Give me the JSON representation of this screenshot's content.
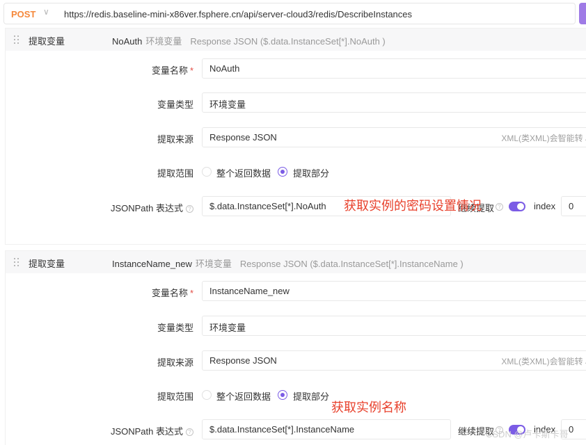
{
  "request": {
    "method": "POST",
    "url": "https://redis.baseline-mini-x86ver.fsphere.cn/api/server-cloud3/redis/DescribeInstances"
  },
  "extractions": [
    {
      "header_title": "提取变量",
      "summary_name": "NoAuth",
      "summary_type": "环境变量",
      "summary_source": "Response JSON ($.data.InstanceSet[*].NoAuth )",
      "name_label": "变量名称",
      "required_mark": "*",
      "name_value": "NoAuth",
      "type_label": "变量类型",
      "type_value": "环境变量",
      "source_label": "提取来源",
      "source_value": "Response JSON",
      "source_hint": "XML(类XML)会智能转 JS",
      "scope_label": "提取范围",
      "scope_options": [
        "整个返回数据",
        "提取部分"
      ],
      "scope_selected": "提取部分",
      "jsonpath_label": "JSONPath 表达式",
      "jsonpath_value": "$.data.InstanceSet[*].NoAuth",
      "continue_label": "继续提取",
      "continue_enabled": true,
      "index_label": "index",
      "index_value": "0"
    },
    {
      "header_title": "提取变量",
      "summary_name": "InstanceName_new",
      "summary_type": "环境变量",
      "summary_source": "Response JSON ($.data.InstanceSet[*].InstanceName )",
      "name_label": "变量名称",
      "required_mark": "*",
      "name_value": "InstanceName_new",
      "type_label": "变量类型",
      "type_value": "环境变量",
      "source_label": "提取来源",
      "source_value": "Response JSON",
      "source_hint": "XML(类XML)会智能转 JS",
      "scope_label": "提取范围",
      "scope_options": [
        "整个返回数据",
        "提取部分"
      ],
      "scope_selected": "提取部分",
      "jsonpath_label": "JSONPath 表达式",
      "jsonpath_value": "$.data.InstanceSet[*].InstanceName",
      "continue_label": "继续提取",
      "continue_enabled": true,
      "index_label": "index",
      "index_value": "0"
    }
  ],
  "annotations": [
    "获取实例的密码设置情况",
    "获取实例名称"
  ],
  "watermark": "CSDN @卢卡斯卡哥",
  "colors": {
    "method": "#f5883b",
    "accent": "#7b5ce5",
    "required": "#e34d45",
    "annotation": "#e8412c"
  },
  "icons": [
    "chevron-down-icon",
    "drag-handle-icon",
    "help-circle-icon"
  ]
}
